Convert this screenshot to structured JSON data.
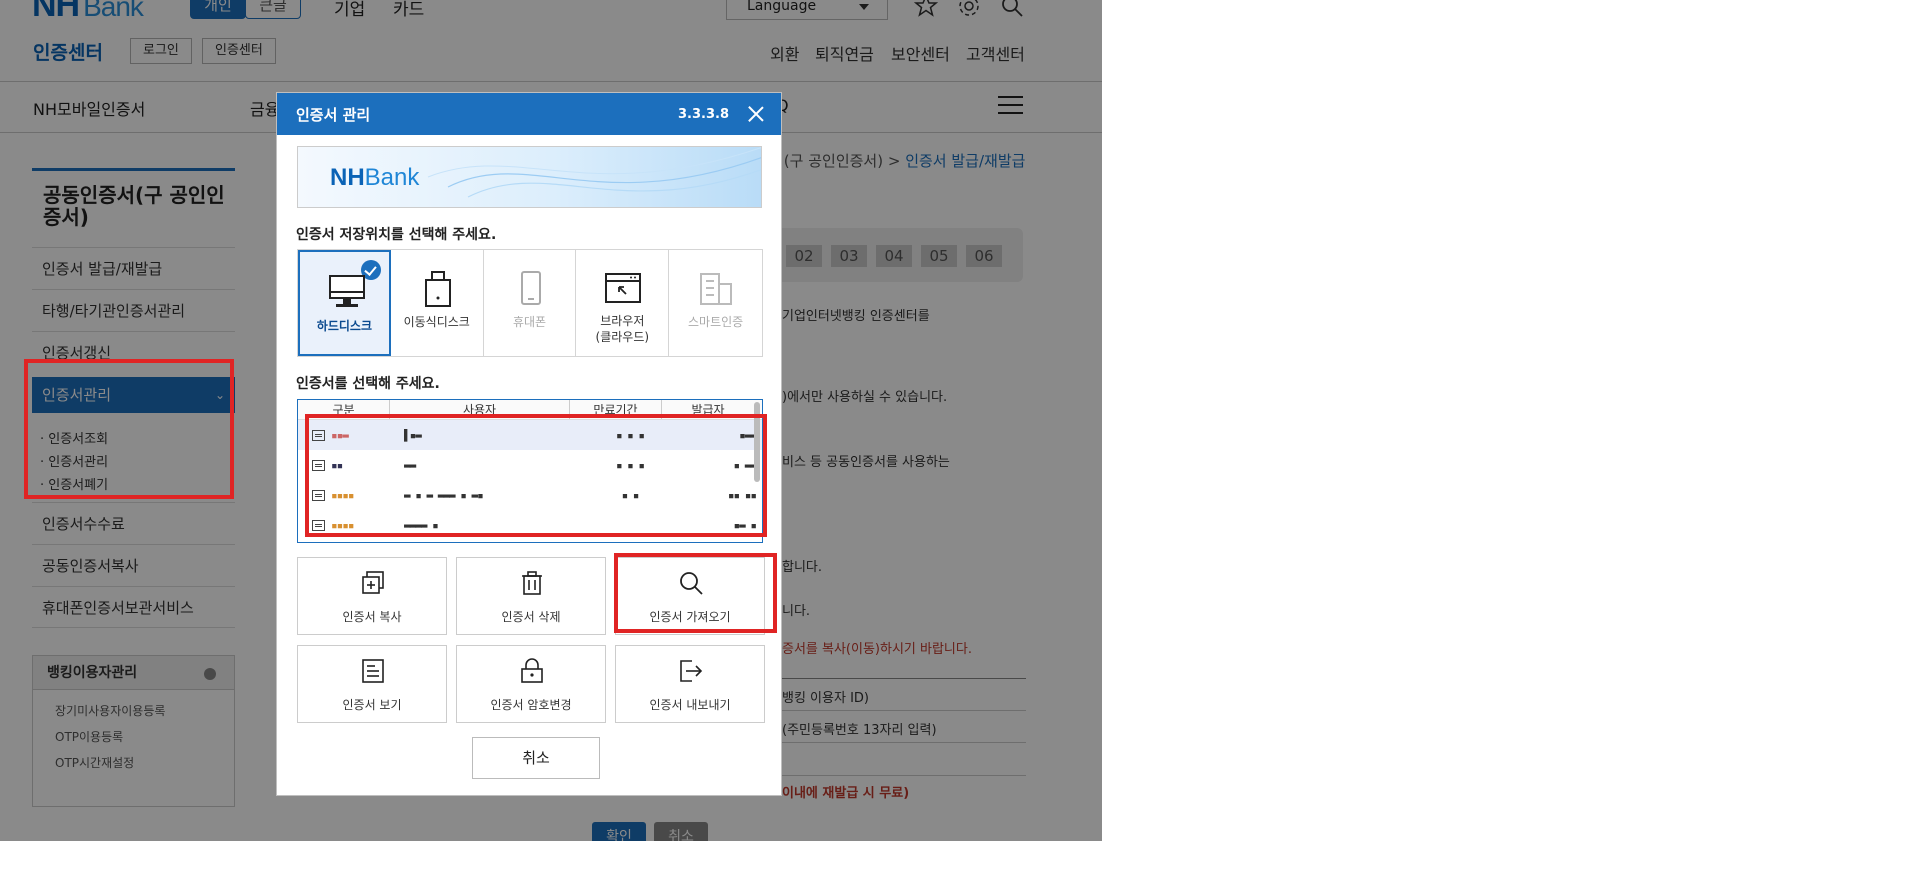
{
  "header": {
    "logo": "NH",
    "logo_sub": "Bank",
    "seg_personal": "개인",
    "seg_large": "큰글",
    "nav_corporate": "기업",
    "nav_card": "카드",
    "language": "Language"
  },
  "subheader": {
    "title": "인증센터",
    "login": "로그인",
    "cert_center": "인증센터",
    "util": [
      "외환",
      "퇴직연금",
      "보안센터",
      "고객센터"
    ]
  },
  "gnb": {
    "mobile_cert": "NH모바일인증서",
    "finance_partial": "금융",
    "faq_partial": "Q"
  },
  "lnb": {
    "title": "공동인증서(구 공인인증서)",
    "items": [
      "인증서 발급/재발급",
      "타행/타기관인증서관리",
      "인증서갱신"
    ],
    "active": "인증서관리",
    "active_chevron": "⌄",
    "sub_items": [
      "· 인증서조회",
      "· 인증서관리",
      "· 인증서폐기"
    ],
    "items_after": [
      "인증서수수료",
      "공동인증서복사",
      "휴대폰인증서보관서비스"
    ],
    "box_title": "뱅킹이용자관리",
    "box_items": [
      "장기미사용자이용등록",
      "OTP이용등록",
      "OTP시간재설정"
    ]
  },
  "content": {
    "breadcrumb_prefix": "서(구 공인인증서) >",
    "breadcrumb_current": "인증서 발급/재발급",
    "steps": [
      "02",
      "03",
      "04",
      "05",
      "06"
    ],
    "lines": [
      "기업인터넷뱅킹 인증센터를",
      ")에서만 사용하실 수 있습니다.",
      "비스 등 공동인증서를 사용하는",
      "합니다.",
      "니다."
    ],
    "red_line": "증서를 복사(이동)하시기 바랍니다.",
    "table_lines": [
      "뱅킹 이용자 ID)",
      "(주민등록번호 13자리 입력)"
    ],
    "red_line2": "이내에 재발급 시 무료)",
    "confirm": "확인",
    "cancel": "취소"
  },
  "dialog": {
    "title": "인증서 관리",
    "version": "3.3.3.8",
    "banner_nh": "NH",
    "banner_bank": "Bank",
    "storage_label": "인증서 저장위치를 선택해 주세요.",
    "storage": [
      {
        "label": "하드디스크",
        "icon": "monitor-icon",
        "state": "selected"
      },
      {
        "label": "이동식디스크",
        "icon": "usb-drive-icon",
        "state": "normal"
      },
      {
        "label": "휴대폰",
        "icon": "phone-icon",
        "state": "disabled"
      },
      {
        "label": "브라우저\n(클라우드)",
        "icon": "browser-icon",
        "state": "normal"
      },
      {
        "label": "스마트인증",
        "icon": "building-icon",
        "state": "disabled"
      }
    ],
    "cert_label": "인증서를 선택해 주세요.",
    "columns": [
      "구분",
      "사용자",
      "만료기간",
      "발급자"
    ],
    "rows": [
      {
        "type": "▪▪▬",
        "user": "▌▪▬",
        "expire": "▪ ▪ ▪",
        "issuer": "▪▬▬"
      },
      {
        "type": "▪▪",
        "user": "▬▬",
        "expire": "▪ ▪ ▪",
        "issuer": "▪ ▬▬"
      },
      {
        "type": "▪▪▪▪",
        "user": "▬ ▪ ▬ ▬▬▬ ▪ ▬▪",
        "expire": "▪ ▪",
        "issuer": "▪▪ ▪▪"
      },
      {
        "type": "▪▪▪▪",
        "user": "▬▬▬▬ ▪",
        "expire": "",
        "issuer": "▪▬ ▪"
      }
    ],
    "actions": [
      {
        "label": "인증서 복사",
        "icon": "copy-icon"
      },
      {
        "label": "인증서 삭제",
        "icon": "trash-icon"
      },
      {
        "label": "인증서 가져오기",
        "icon": "search-icon"
      },
      {
        "label": "인증서 보기",
        "icon": "document-icon"
      },
      {
        "label": "인증서 암호변경",
        "icon": "lock-icon"
      },
      {
        "label": "인증서 내보내기",
        "icon": "export-icon"
      }
    ],
    "cancel": "취소"
  },
  "colors": {
    "brand_blue": "#1c6fbd",
    "highlight_red": "#e02424"
  }
}
